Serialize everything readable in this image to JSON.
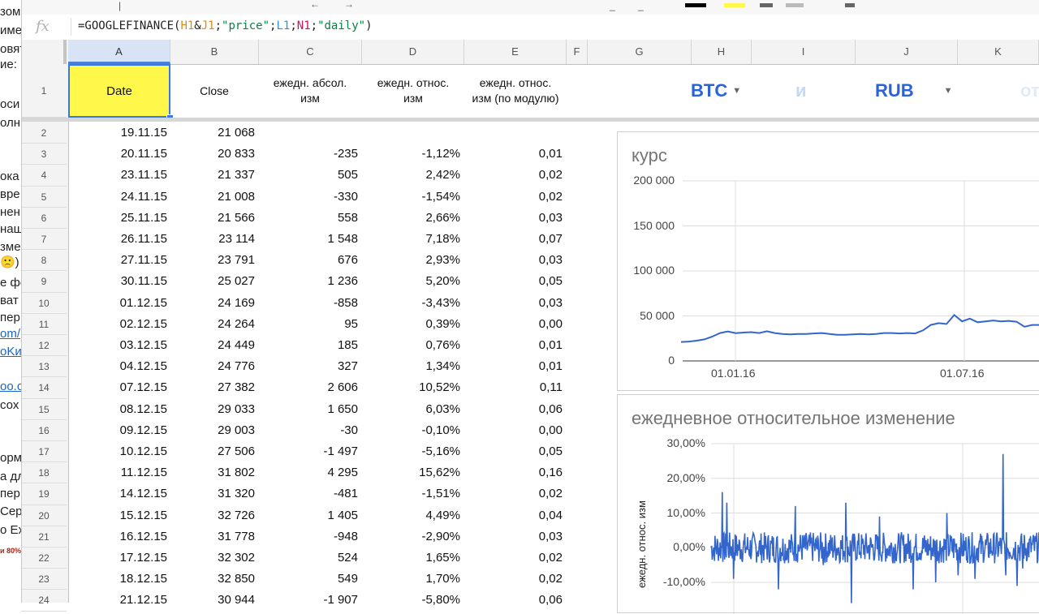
{
  "left_panel_fragments": [
    {
      "text": "зом",
      "top": 6
    },
    {
      "text": "име",
      "top": 29
    },
    {
      "text": "овят",
      "top": 52
    },
    {
      "text": "ие:",
      "top": 71
    },
    {
      "text": "оси",
      "top": 120
    },
    {
      "text": "олн",
      "top": 143
    },
    {
      "text": "ока",
      "top": 209
    },
    {
      "text": "вре",
      "top": 231
    },
    {
      "text": "нен",
      "top": 253
    },
    {
      "text": "наш",
      "top": 274
    },
    {
      "text": "зме",
      "top": 296
    },
    {
      "text": "🙁)",
      "top": 314
    },
    {
      "text": "е фо",
      "top": 340
    },
    {
      "text": "ват",
      "top": 362
    },
    {
      "text": "пер",
      "top": 383
    },
    {
      "text": "om/",
      "top": 403,
      "link": true
    },
    {
      "text": "oKи",
      "top": 425,
      "link": true
    },
    {
      "text": "oo.c",
      "top": 468,
      "link": true
    },
    {
      "text": "сох",
      "top": 491
    },
    {
      "text": "орм",
      "top": 556
    },
    {
      "text": "а дл",
      "top": 579
    },
    {
      "text": "пер",
      "top": 600
    },
    {
      "text": "Сер",
      "top": 622
    },
    {
      "text": "o Ex",
      "top": 645
    },
    {
      "text": "и 80%",
      "top": 674,
      "red": true
    }
  ],
  "formula_bar": {
    "fx_label": "fx",
    "parts": [
      {
        "t": "=GOOGLEFINANCE(",
        "c": ""
      },
      {
        "t": "H1",
        "c": "r1"
      },
      {
        "t": "&",
        "c": ""
      },
      {
        "t": "J1",
        "c": "r1"
      },
      {
        "t": ";",
        "c": ""
      },
      {
        "t": "\"price\"",
        "c": "str"
      },
      {
        "t": ";",
        "c": ""
      },
      {
        "t": "L1",
        "c": "r2"
      },
      {
        "t": ";",
        "c": ""
      },
      {
        "t": "N1",
        "c": "r3"
      },
      {
        "t": ";",
        "c": ""
      },
      {
        "t": "\"daily\"",
        "c": "str"
      },
      {
        "t": ")",
        "c": ""
      }
    ]
  },
  "columns": [
    "A",
    "B",
    "C",
    "D",
    "E",
    "F",
    "G",
    "H",
    "I",
    "J",
    "K"
  ],
  "header_row": {
    "row_num": "1",
    "date": "Date",
    "close": "Close",
    "abs": "ежедн. абсол. изм",
    "rel": "ежедн. относ. изм",
    "rel_abs": "ежедн. относ. изм (по модулю)",
    "currency_from": "BTC",
    "connector": "и",
    "currency_to": "RUB",
    "cut_label": "от"
  },
  "rows": [
    {
      "n": "2",
      "date": "19.11.15",
      "close": "21 068",
      "abs": "",
      "rel": "",
      "mod": ""
    },
    {
      "n": "3",
      "date": "20.11.15",
      "close": "20 833",
      "abs": "-235",
      "rel": "-1,12%",
      "mod": "0,01"
    },
    {
      "n": "4",
      "date": "23.11.15",
      "close": "21 337",
      "abs": "505",
      "rel": "2,42%",
      "mod": "0,02"
    },
    {
      "n": "5",
      "date": "24.11.15",
      "close": "21 008",
      "abs": "-330",
      "rel": "-1,54%",
      "mod": "0,02"
    },
    {
      "n": "6",
      "date": "25.11.15",
      "close": "21 566",
      "abs": "558",
      "rel": "2,66%",
      "mod": "0,03"
    },
    {
      "n": "7",
      "date": "26.11.15",
      "close": "23 114",
      "abs": "1 548",
      "rel": "7,18%",
      "mod": "0,07"
    },
    {
      "n": "8",
      "date": "27.11.15",
      "close": "23 791",
      "abs": "676",
      "rel": "2,93%",
      "mod": "0,03"
    },
    {
      "n": "9",
      "date": "30.11.15",
      "close": "25 027",
      "abs": "1 236",
      "rel": "5,20%",
      "mod": "0,05"
    },
    {
      "n": "10",
      "date": "01.12.15",
      "close": "24 169",
      "abs": "-858",
      "rel": "-3,43%",
      "mod": "0,03"
    },
    {
      "n": "11",
      "date": "02.12.15",
      "close": "24 264",
      "abs": "95",
      "rel": "0,39%",
      "mod": "0,00"
    },
    {
      "n": "12",
      "date": "03.12.15",
      "close": "24 449",
      "abs": "185",
      "rel": "0,76%",
      "mod": "0,01"
    },
    {
      "n": "13",
      "date": "04.12.15",
      "close": "24 776",
      "abs": "327",
      "rel": "1,34%",
      "mod": "0,01"
    },
    {
      "n": "14",
      "date": "07.12.15",
      "close": "27 382",
      "abs": "2 606",
      "rel": "10,52%",
      "mod": "0,11"
    },
    {
      "n": "15",
      "date": "08.12.15",
      "close": "29 033",
      "abs": "1 650",
      "rel": "6,03%",
      "mod": "0,06"
    },
    {
      "n": "16",
      "date": "09.12.15",
      "close": "29 003",
      "abs": "-30",
      "rel": "-0,10%",
      "mod": "0,00"
    },
    {
      "n": "17",
      "date": "10.12.15",
      "close": "27 506",
      "abs": "-1 497",
      "rel": "-5,16%",
      "mod": "0,05"
    },
    {
      "n": "18",
      "date": "11.12.15",
      "close": "31 802",
      "abs": "4 295",
      "rel": "15,62%",
      "mod": "0,16"
    },
    {
      "n": "19",
      "date": "14.12.15",
      "close": "31 320",
      "abs": "-481",
      "rel": "-1,51%",
      "mod": "0,02"
    },
    {
      "n": "20",
      "date": "15.12.15",
      "close": "32 726",
      "abs": "1 405",
      "rel": "4,49%",
      "mod": "0,04"
    },
    {
      "n": "21",
      "date": "16.12.15",
      "close": "31 778",
      "abs": "-948",
      "rel": "-2,90%",
      "mod": "0,03"
    },
    {
      "n": "22",
      "date": "17.12.15",
      "close": "32 302",
      "abs": "524",
      "rel": "1,65%",
      "mod": "0,02"
    },
    {
      "n": "23",
      "date": "18.12.15",
      "close": "32 850",
      "abs": "549",
      "rel": "1,70%",
      "mod": "0,02"
    },
    {
      "n": "24",
      "date": "21.12.15",
      "close": "30 944",
      "abs": "-1 907",
      "rel": "-5,80%",
      "mod": "0,06"
    }
  ],
  "chart_data": [
    {
      "type": "line",
      "title": "курс",
      "y_ticks": [
        "200 000",
        "150 000",
        "100 000",
        "50 000",
        "0"
      ],
      "ylim": [
        0,
        200000
      ],
      "x_ticks": [
        "01.01.16",
        "01.07.16"
      ],
      "series": [
        {
          "values": [
            21068,
            21500,
            22500,
            24000,
            27000,
            31000,
            32800,
            30900,
            31500,
            32000,
            31000,
            33000,
            31000,
            30000,
            29500,
            30000,
            30000,
            30500,
            31000,
            30000,
            29000,
            29000,
            29500,
            30000,
            29500,
            30000,
            31000,
            31000,
            30500,
            31000,
            30500,
            34000,
            40000,
            42000,
            41000,
            51000,
            44000,
            47000,
            43000,
            44000,
            45000,
            44000,
            44500,
            43500,
            38000,
            40000,
            40000,
            38500
          ]
        }
      ],
      "color": "#3366cc"
    },
    {
      "type": "line",
      "title": "ежедневное относительное изменение",
      "ylabel": "ежедн. относ. изм",
      "y_ticks": [
        "30,00%",
        "20,00%",
        "10,00%",
        "0,00%",
        "-10,00%"
      ],
      "ylim": [
        -10,
        30
      ],
      "color": "#3366cc"
    }
  ]
}
